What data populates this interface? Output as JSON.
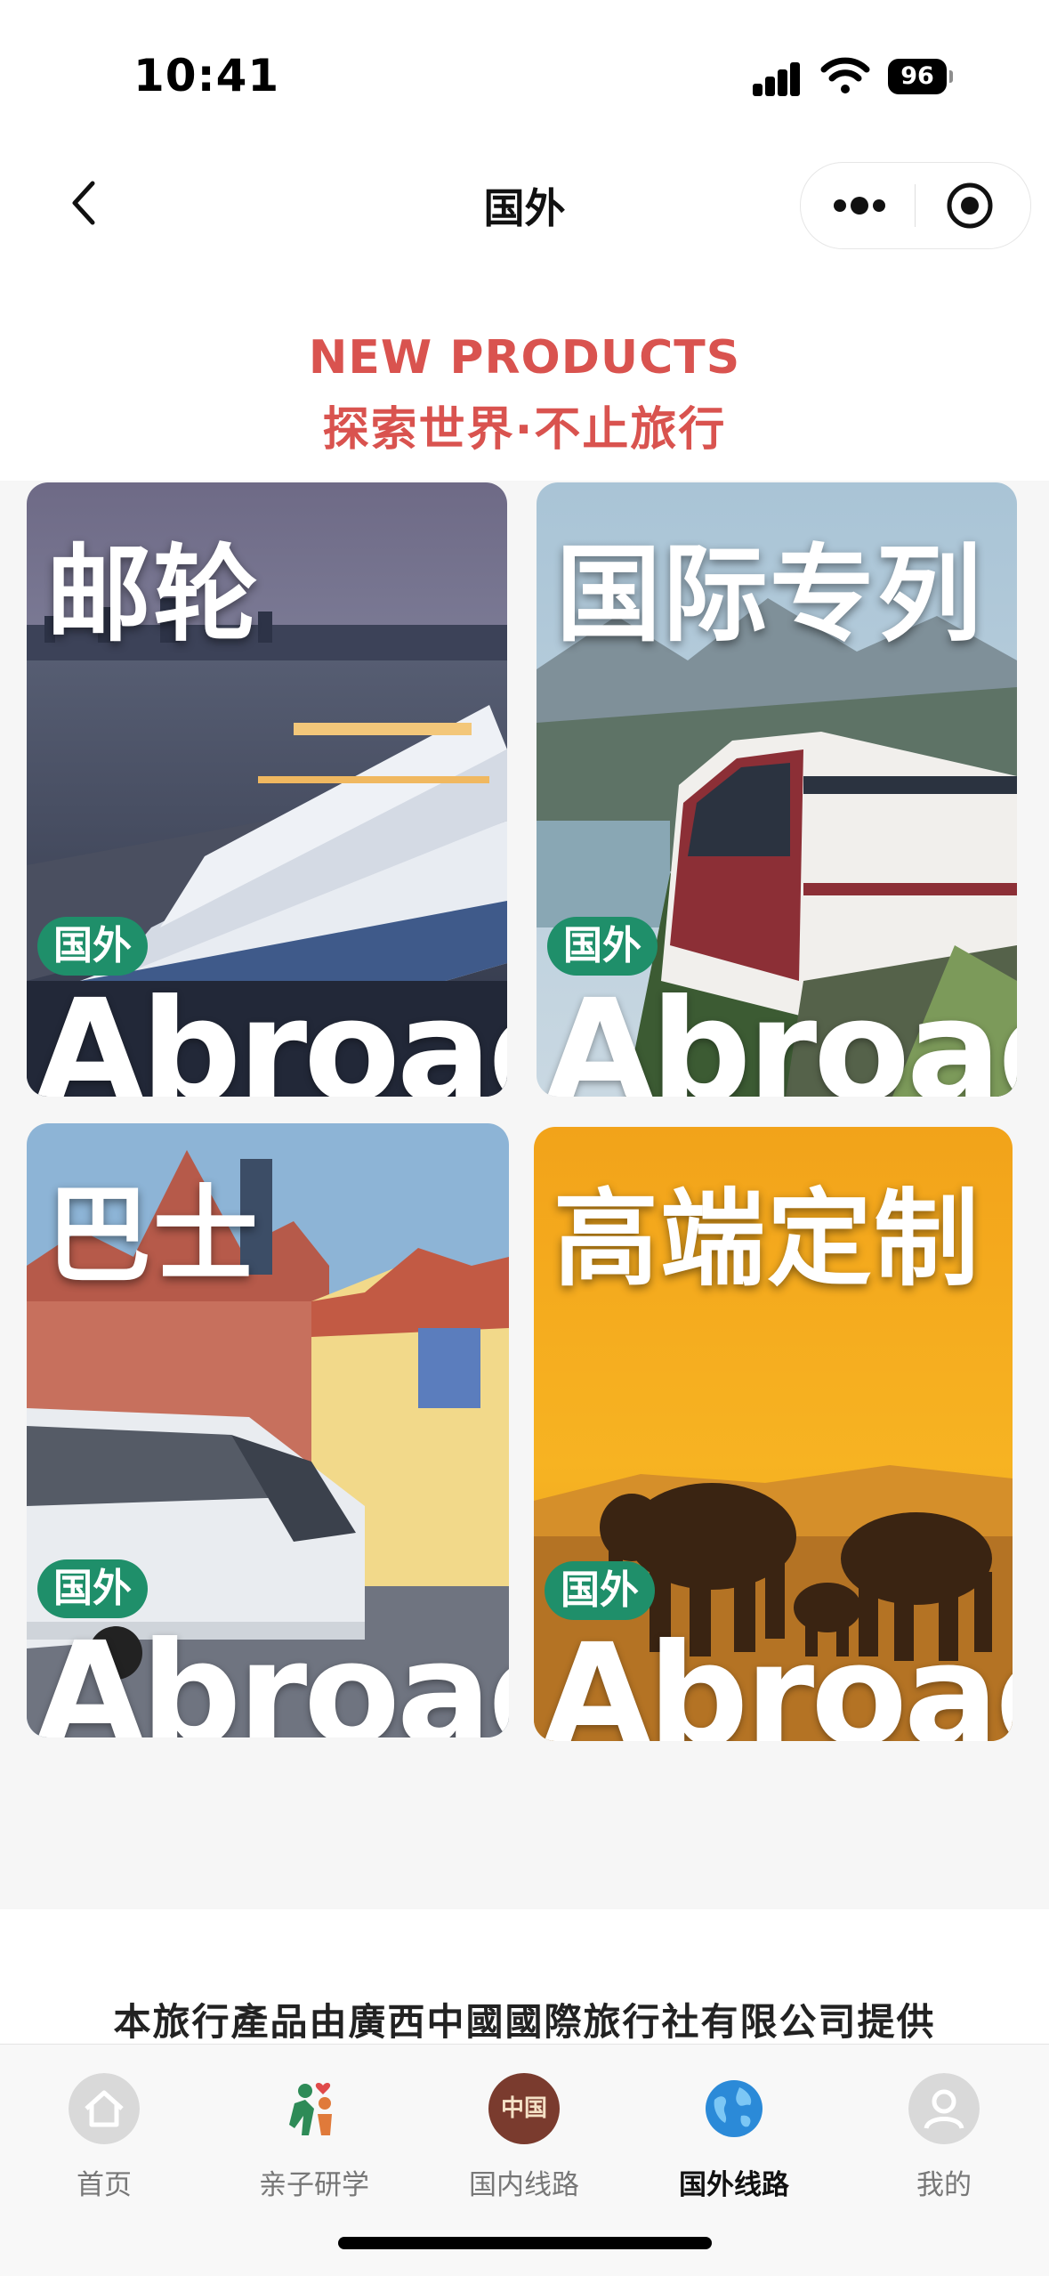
{
  "status_bar": {
    "time": "10:41",
    "battery": "96"
  },
  "nav": {
    "title": "国外"
  },
  "heading": {
    "en": "NEW PRODUCTS",
    "zh": "探索世界·不止旅行"
  },
  "cards": [
    {
      "title": "邮轮",
      "badge": "国外",
      "subtitle": "Abroad"
    },
    {
      "title": "国际专列",
      "badge": "国外",
      "subtitle": "Abroad"
    },
    {
      "title": "巴士",
      "badge": "国外",
      "subtitle": "Abroad"
    },
    {
      "title": "高端定制",
      "badge": "国外",
      "subtitle": "Abroad"
    }
  ],
  "provider": "本旅行產品由廣西中國國際旅行社有限公司提供",
  "tabs": [
    {
      "label": "首页",
      "icon": "home-icon",
      "active": false
    },
    {
      "label": "亲子研学",
      "icon": "family-icon",
      "active": false
    },
    {
      "label": "国内线路",
      "icon": "china-seal-icon",
      "icon_text": "中国",
      "active": false
    },
    {
      "label": "国外线路",
      "icon": "globe-icon",
      "active": true
    },
    {
      "label": "我的",
      "icon": "user-icon",
      "active": false
    }
  ],
  "colors": {
    "accent": "#d9534f",
    "badge": "#1f8f6a"
  }
}
